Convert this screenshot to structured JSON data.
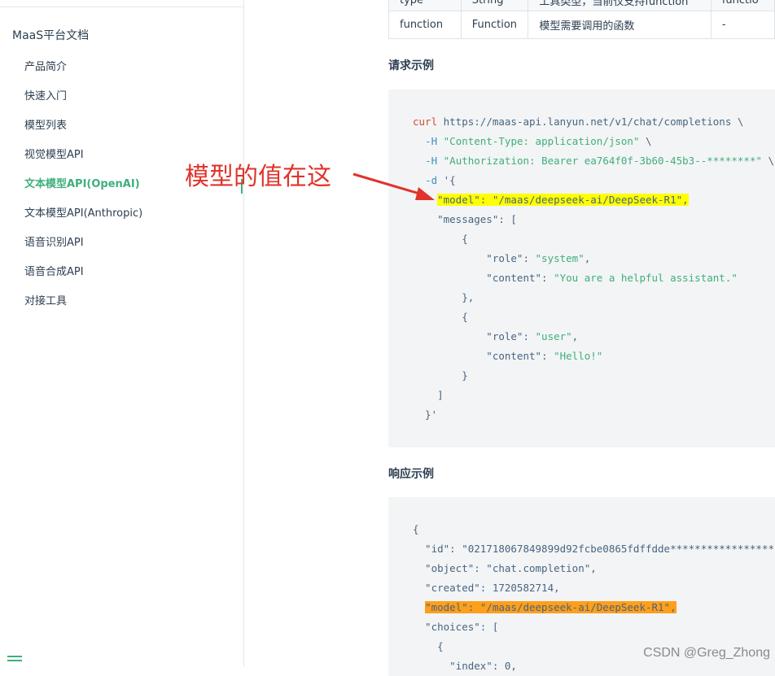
{
  "sidebar": {
    "section_title": "MaaS平台文档",
    "items": [
      {
        "label": "产品简介"
      },
      {
        "label": "快速入门"
      },
      {
        "label": "模型列表"
      },
      {
        "label": "视觉模型API"
      },
      {
        "label": "文本模型API(OpenAI)",
        "active": true
      },
      {
        "label": "文本模型API(Anthropic)"
      },
      {
        "label": "语音识别API"
      },
      {
        "label": "语音合成API"
      },
      {
        "label": "对接工具"
      }
    ]
  },
  "params_table": {
    "rows": [
      [
        "type",
        "String",
        "工具类型，当前仅支持function",
        "functio"
      ],
      [
        "function",
        "Function",
        "模型需要调用的函数",
        "-"
      ]
    ]
  },
  "request_example": {
    "heading": "请求示例",
    "lines": [
      "curl https://maas-api.lanyun.net/v1/chat/completions \\",
      "  -H \"Content-Type: application/json\" \\",
      "  -H \"Authorization: Bearer ea764f0f-3b60-45b3--********\" \\",
      "  -d '{",
      "    \"model\": \"/maas/deepseek-ai/DeepSeek-R1\",",
      "    \"messages\": [",
      "        {",
      "            \"role\": \"system\",",
      "            \"content\": \"You are a helpful assistant.\"",
      "        },",
      "        {",
      "            \"role\": \"user\",",
      "            \"content\": \"Hello!\"",
      "        }",
      "    ]",
      "  }'"
    ]
  },
  "response_example": {
    "heading": "响应示例",
    "lines": [
      "{",
      "  \"id\": \"021718067849899d92fcbe0865fdffdde*****************\",",
      "  \"object\": \"chat.completion\",",
      "  \"created\": 1720582714,",
      "  \"model\": \"/maas/deepseek-ai/DeepSeek-R1\",",
      "  \"choices\": [",
      "    {",
      "      \"index\": 0,"
    ]
  },
  "annotation": {
    "text": "模型的值在这",
    "color": "#e0332b"
  },
  "watermark": "CSDN @Greg_Zhong",
  "colors": {
    "accent": "#3eaf7c",
    "highlight_yellow": "#ffff00",
    "highlight_orange": "#ff9f1a"
  }
}
